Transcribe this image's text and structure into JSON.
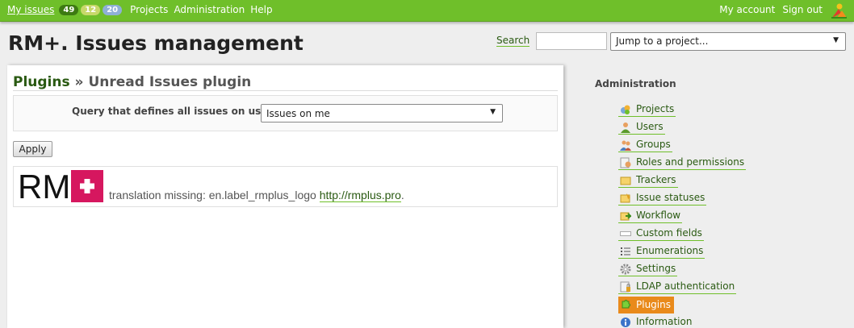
{
  "top_menu": {
    "my_issues": "My issues",
    "badges": [
      "49",
      "12",
      "20"
    ],
    "links": [
      "Projects",
      "Administration",
      "Help"
    ],
    "my_account": "My account",
    "sign_out": "Sign out"
  },
  "header": {
    "title": "RM+. Issues management",
    "search_label": "Search",
    "search_value": "",
    "jump_to_project": "Jump to a project..."
  },
  "content": {
    "breadcrumb_link": "Plugins",
    "breadcrumb_separator": " » ",
    "page_heading": "Unread Issues plugin",
    "query_label": "Query that defines all issues on user:",
    "query_value": "Issues on me",
    "apply_label": "Apply",
    "logo_note": "translation missing: en.label_rmplus_logo",
    "logo_link": "http://rmplus.pro",
    "logo_link_suffix": ".",
    "logo_letters": "RM"
  },
  "sidebar": {
    "heading": "Administration",
    "items": [
      {
        "label": "Projects",
        "icon": "projects-icon"
      },
      {
        "label": "Users",
        "icon": "user-icon"
      },
      {
        "label": "Groups",
        "icon": "group-icon"
      },
      {
        "label": "Roles and permissions",
        "icon": "roles-icon"
      },
      {
        "label": "Trackers",
        "icon": "tracker-icon"
      },
      {
        "label": "Issue statuses",
        "icon": "status-icon"
      },
      {
        "label": "Workflow",
        "icon": "workflow-icon"
      },
      {
        "label": "Custom fields",
        "icon": "custom-field-icon"
      },
      {
        "label": "Enumerations",
        "icon": "list-icon"
      },
      {
        "label": "Settings",
        "icon": "gear-icon"
      },
      {
        "label": "LDAP authentication",
        "icon": "ldap-icon"
      },
      {
        "label": "Plugins",
        "icon": "plugin-icon",
        "selected": true
      },
      {
        "label": "Information",
        "icon": "info-icon"
      }
    ]
  },
  "colors": {
    "accent_green": "#6fbf2a",
    "link_green": "#2a5a12",
    "selected_orange": "#e98a1b",
    "logo_magenta": "#d6175f"
  }
}
